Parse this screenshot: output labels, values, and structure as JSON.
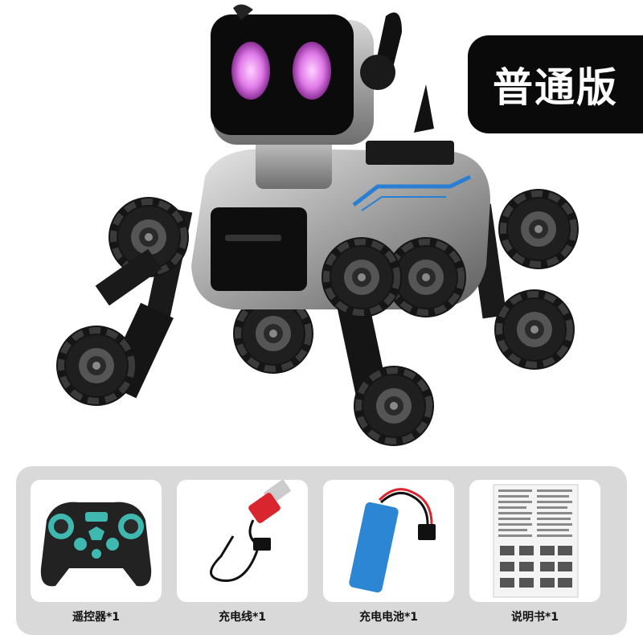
{
  "badge": {
    "label": "普通版"
  },
  "accessories": [
    {
      "caption": "遥控器*1"
    },
    {
      "caption": "充电线*1"
    },
    {
      "caption": "充电电池*1"
    },
    {
      "caption": "说明书*1"
    }
  ],
  "colors": {
    "badge_bg": "#0a0a0a",
    "bar_bg": "#d9d9d9",
    "robot_eyes": "#e07ae8",
    "robot_accent": "#2a7fd4"
  }
}
